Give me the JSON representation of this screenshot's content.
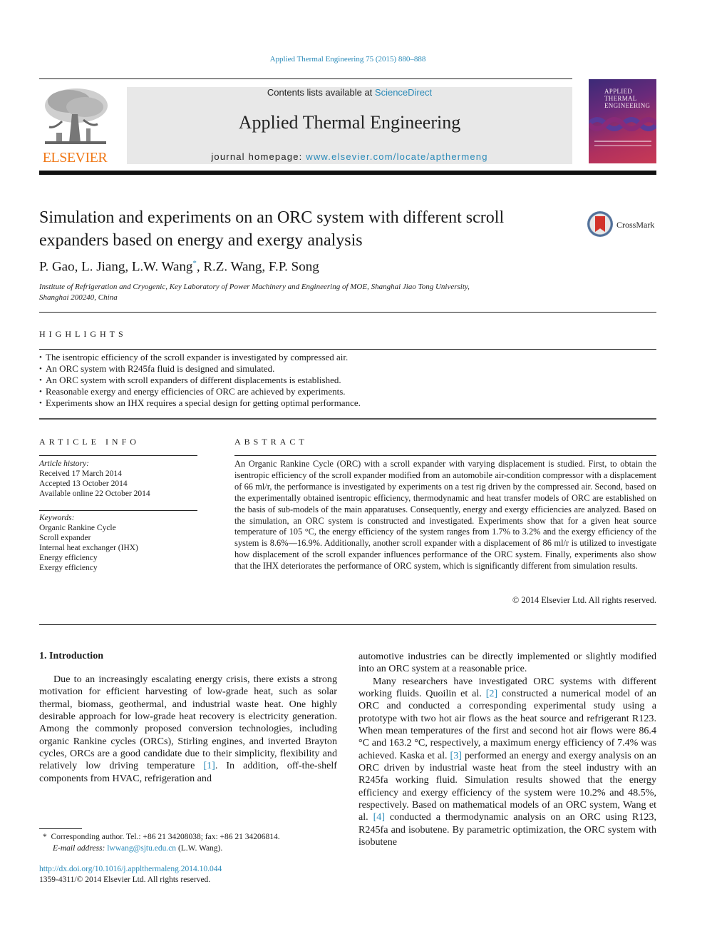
{
  "header": {
    "journal_ref": "Applied Thermal Engineering 75 (2015) 880–888",
    "contents_prefix": "Contents lists available at ",
    "contents_link": "ScienceDirect",
    "journal_title": "Applied Thermal Engineering",
    "homepage_prefix": "journal homepage: ",
    "homepage_link": "www.elsevier.com/locate/apthermeng",
    "publisher_logo_text": "ELSEVIER",
    "cover_title_lines": [
      "Applied",
      "Thermal",
      "Engineering"
    ],
    "publisher_logo_color": "#f07a1a",
    "link_color": "#2a8ab8"
  },
  "article": {
    "title": "Simulation and experiments on an ORC system with different scroll expanders based on energy and exergy analysis",
    "crossmark_label": "CrossMark",
    "authors_before": "P. Gao, L. Jiang, L.W. Wang",
    "corresponding_marker": "*",
    "authors_after": ", R.Z. Wang, F.P. Song",
    "affiliation_line1": "Institute of Refrigeration and Cryogenic, Key Laboratory of Power Machinery and Engineering of MOE, Shanghai Jiao Tong University,",
    "affiliation_line2": "Shanghai 200240, China"
  },
  "highlights": {
    "heading": "HIGHLIGHTS",
    "items": [
      "The isentropic efficiency of the scroll expander is investigated by compressed air.",
      "An ORC system with R245fa fluid is designed and simulated.",
      "An ORC system with scroll expanders of different displacements is established.",
      "Reasonable exergy and energy efficiencies of ORC are achieved by experiments.",
      "Experiments show an IHX requires a special design for getting optimal performance."
    ]
  },
  "article_info": {
    "heading": "ARTICLE INFO",
    "history_label": "Article history:",
    "history": [
      "Received 17 March 2014",
      "Accepted 13 October 2014",
      "Available online 22 October 2014"
    ],
    "keywords_label": "Keywords:",
    "keywords": [
      "Organic Rankine Cycle",
      "Scroll expander",
      "Internal heat exchanger (IHX)",
      "Energy efficiency",
      "Exergy efficiency"
    ]
  },
  "abstract": {
    "heading": "ABSTRACT",
    "text": "An Organic Rankine Cycle (ORC) with a scroll expander with varying displacement is studied. First, to obtain the isentropic efficiency of the scroll expander modified from an automobile air-condition compressor with a displacement of 66 ml/r, the performance is investigated by experiments on a test rig driven by the compressed air. Second, based on the experimentally obtained isentropic efficiency, thermodynamic and heat transfer models of ORC are established on the basis of sub-models of the main apparatuses. Consequently, energy and exergy efficiencies are analyzed. Based on the simulation, an ORC system is constructed and investigated. Experiments show that for a given heat source temperature of 105 °C, the energy efficiency of the system ranges from 1.7% to 3.2% and the exergy efficiency of the system is 8.6%—16.9%. Additionally, another scroll expander with a displacement of 86 ml/r is utilized to investigate how displacement of the scroll expander influences performance of the ORC system. Finally, experiments also show that the IHX deteriorates the performance of ORC system, which is significantly different from simulation results.",
    "copyright": "© 2014 Elsevier Ltd. All rights reserved."
  },
  "introduction": {
    "heading": "1.  Introduction",
    "p1_before": "Due to an increasingly escalating energy crisis, there exists a strong motivation for efficient harvesting of low-grade heat, such as solar thermal, biomass, geothermal, and industrial waste heat. One highly desirable approach for low-grade heat recovery is electricity generation. Among the commonly proposed conversion technologies, including organic Rankine cycles (ORCs), Stirling engines, and inverted Brayton cycles, ORCs are a good candidate due to their simplicity, flexibility and relatively low driving temperature ",
    "p1_ref": "[1]",
    "p1_after": ". In addition, off-the-shelf components from HVAC, refrigeration and",
    "p1_cont": "automotive industries can be directly implemented or slightly modified into an ORC system at a reasonable price.",
    "p2_a": "Many researchers have investigated ORC systems with different working fluids. Quoilin et al. ",
    "p2_ref1": "[2]",
    "p2_b": " constructed a numerical model of an ORC and conducted a corresponding experimental study using a prototype with two hot air flows as the heat source and refrigerant R123. When mean temperatures of the first and second hot air flows were 86.4 °C and 163.2 °C, respectively, a maximum energy efficiency of 7.4% was achieved. Kaska et al. ",
    "p2_ref2": "[3]",
    "p2_c": " performed an energy and exergy analysis on an ORC driven by industrial waste heat from the steel industry with an R245fa working fluid. Simulation results showed that the energy efficiency and exergy efficiency of the system were 10.2% and 48.5%, respectively. Based on mathematical models of an ORC system, Wang et al. ",
    "p2_ref3": "[4]",
    "p2_d": " conducted a thermodynamic analysis on an ORC using R123, R245fa and isobutene. By parametric optimization, the ORC system with isobutene"
  },
  "footnote": {
    "marker": "*",
    "text": "Corresponding author. Tel.: +86 21 34208038; fax: +86 21 34206814.",
    "email_label": "E-mail address:",
    "email": "lwwang@sjtu.edu.cn",
    "email_suffix": " (L.W. Wang)."
  },
  "doi": {
    "link": "http://dx.doi.org/10.1016/j.applthermaleng.2014.10.044",
    "issn_line": "1359-4311/© 2014 Elsevier Ltd. All rights reserved."
  }
}
